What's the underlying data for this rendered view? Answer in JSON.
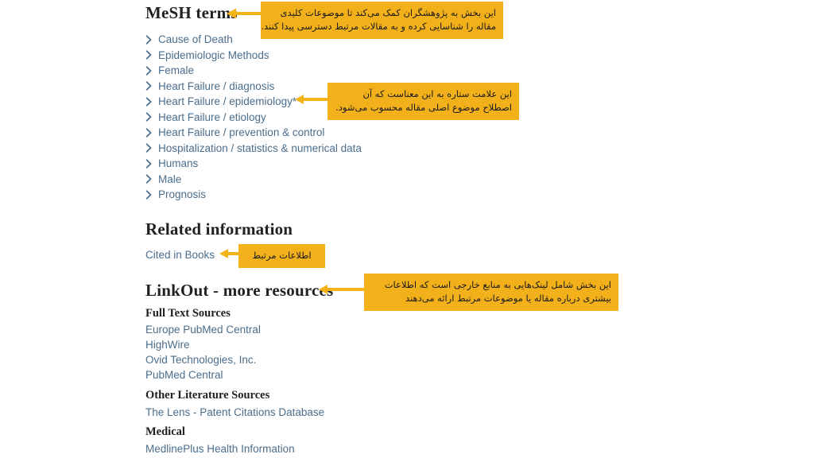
{
  "page": {
    "language_of_annotations": "Persian"
  },
  "mesh_section": {
    "heading": "MeSH terms",
    "terms": [
      {
        "label": "Cause of Death"
      },
      {
        "label": "Epidemiologic Methods"
      },
      {
        "label": "Female"
      },
      {
        "label": "Heart Failure / diagnosis"
      },
      {
        "label": "Heart Failure / epidemiology*"
      },
      {
        "label": "Heart Failure / etiology"
      },
      {
        "label": "Heart Failure / prevention & control"
      },
      {
        "label": "Hospitalization / statistics & numerical data"
      },
      {
        "label": "Humans"
      },
      {
        "label": "Male"
      },
      {
        "label": "Prognosis"
      }
    ]
  },
  "related_information": {
    "heading": "Related information",
    "links": [
      {
        "label": "Cited in Books"
      }
    ]
  },
  "linkout": {
    "heading": "LinkOut - more resources",
    "groups": [
      {
        "title": "Full Text Sources",
        "links": [
          {
            "label": "Europe PubMed Central"
          },
          {
            "label": "HighWire"
          },
          {
            "label": "Ovid Technologies, Inc."
          },
          {
            "label": "PubMed Central"
          }
        ]
      },
      {
        "title": "Other Literature Sources",
        "links": [
          {
            "label": "The Lens - Patent Citations Database"
          }
        ]
      },
      {
        "title": "Medical",
        "links": [
          {
            "label": "MedlinePlus Health Information"
          }
        ]
      }
    ]
  },
  "annotations": [
    {
      "id": "mesh-terms-note",
      "lines": [
        "این بخش به پژوهشگران کمک می‌کند تا موضوعات کلیدی",
        "مقاله را شناسایی کرده و به مقالات مرتبط دسترسی پیدا کنند."
      ]
    },
    {
      "id": "asterisk-note",
      "lines": [
        "این علامت ستاره به این معناست که آن",
        "اصطلاح موضوع اصلی مقاله محسوب می‌شود."
      ]
    },
    {
      "id": "related-information-note",
      "lines": [
        "اطلاعات مرتبط"
      ]
    },
    {
      "id": "linkout-note",
      "lines": [
        "این بخش شامل لینک‌هایی به منابع خارجی است که اطلاعات",
        "بیشتری درباره مقاله یا موضوعات مرتبط ارائه می‌دهند"
      ]
    }
  ],
  "colors": {
    "callout_background": "#f2b01a",
    "arrow": "#f5b31a",
    "link_text": "#4a6d8c",
    "heading_text": "#212121",
    "page_background": "#ffffff"
  }
}
